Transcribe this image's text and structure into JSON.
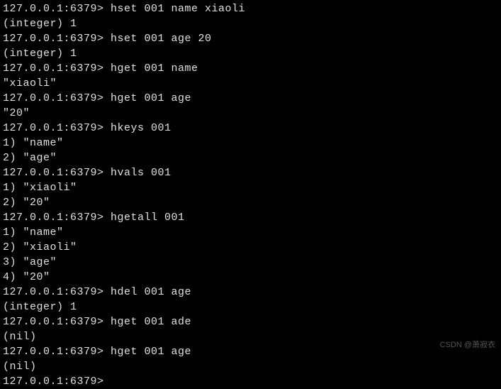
{
  "terminal": {
    "lines": [
      {
        "prompt": "127.0.0.1:6379>",
        "cmd": " hset 001 name xiaoli"
      },
      {
        "out": "(integer) 1"
      },
      {
        "prompt": "127.0.0.1:6379>",
        "cmd": " hset 001 age 20"
      },
      {
        "out": "(integer) 1"
      },
      {
        "prompt": "127.0.0.1:6379>",
        "cmd": " hget 001 name"
      },
      {
        "out": "\"xiaoli\""
      },
      {
        "prompt": "127.0.0.1:6379>",
        "cmd": " hget 001 age"
      },
      {
        "out": "\"20\""
      },
      {
        "prompt": "127.0.0.1:6379>",
        "cmd": " hkeys 001"
      },
      {
        "out": "1) \"name\""
      },
      {
        "out": "2) \"age\""
      },
      {
        "prompt": "127.0.0.1:6379>",
        "cmd": " hvals 001"
      },
      {
        "out": "1) \"xiaoli\""
      },
      {
        "out": "2) \"20\""
      },
      {
        "prompt": "127.0.0.1:6379>",
        "cmd": " hgetall 001"
      },
      {
        "out": "1) \"name\""
      },
      {
        "out": "2) \"xiaoli\""
      },
      {
        "out": "3) \"age\""
      },
      {
        "out": "4) \"20\""
      },
      {
        "prompt": "127.0.0.1:6379>",
        "cmd": " hdel 001 age"
      },
      {
        "out": "(integer) 1"
      },
      {
        "prompt": "127.0.0.1:6379>",
        "cmd": " hget 001 ade"
      },
      {
        "out": "(nil)"
      },
      {
        "prompt": "127.0.0.1:6379>",
        "cmd": " hget 001 age"
      },
      {
        "out": "(nil)"
      },
      {
        "prompt": "127.0.0.1:6379>",
        "cmd": ""
      }
    ]
  },
  "watermark": "CSDN @萧寂衣"
}
